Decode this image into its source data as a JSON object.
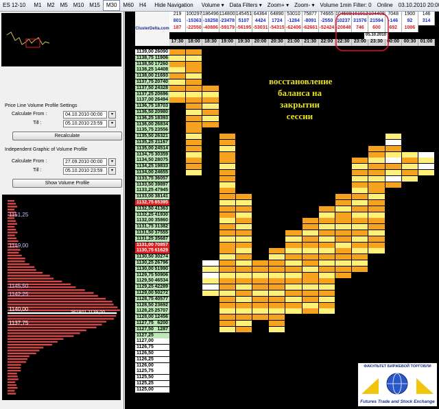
{
  "toolbar": {
    "items": [
      "ES 12-10",
      "M1",
      "M2",
      "M5",
      "M10",
      "M15",
      "M30",
      "M60",
      "H4",
      "Hide Navigation",
      "Volume ▾",
      "Data Filters ▾",
      "Zoom+ ▾",
      "Zoom- ▾",
      "Volume 1min Filter: 0",
      "Online",
      "03.10.2010 20:00 ▾"
    ]
  },
  "left": {
    "price_line_title": "Price Line Volume Profile Settings",
    "calc_from_label": "Calculate From :",
    "till_label": "Till :",
    "pl_from": "04.10.2010 00:00",
    "pl_till": "05.10.2010 23:59",
    "recalc": "Recalculate",
    "indep_title": "Independent Graphic of Volume Profile",
    "ig_from": "27.09.2010 00:00",
    "ig_till": "05.10.2010 23:59",
    "show_profile": "Show Volume Profile",
    "profile_prices": [
      "1151,25",
      "1149,00",
      "1145,50",
      "1142,25",
      "1140,00",
      "1137,75"
    ],
    "profile_max": "361801  1139,00"
  },
  "header": {
    "row1": [
      "219",
      "100297",
      "186496",
      "114800",
      "145451",
      "64364",
      "64890",
      "53010",
      "75877",
      "74665",
      "104509",
      "161912",
      "104408",
      "7048",
      "1900",
      "146"
    ],
    "row2": [
      "801",
      "-15363",
      "-18258",
      "-23478",
      "5107",
      "4424",
      "1724",
      "-1284",
      "-8091",
      "-2550",
      "10237",
      "31576",
      "21594",
      "-146",
      "92",
      "314"
    ],
    "row3": [
      "187",
      "-22550",
      "-40886",
      "-59179",
      "-56195",
      "-53031",
      "-54315",
      "-62406",
      "-62661",
      "-52424",
      "-20848",
      "746",
      "600",
      "692",
      "1006"
    ],
    "times": [
      "17:30",
      "18:00",
      "18:30",
      "19:00",
      "19:30",
      "20:00",
      "20:30",
      "21:00",
      "21:30",
      "22:00",
      "22:30",
      "23:00",
      "23:30",
      "00:00",
      "00:30",
      "01:00"
    ],
    "date_mark": "05.10.2010",
    "brand": "ClusterDelta.com"
  },
  "prices": [
    [
      "1139,00",
      "26090"
    ],
    [
      "1138,75",
      "11906"
    ],
    [
      "1138,50",
      "17260"
    ],
    [
      "1138,25",
      "14408"
    ],
    [
      "1138,00",
      "21693"
    ],
    [
      "1137,75",
      "20740"
    ],
    [
      "1137,50",
      "24328"
    ],
    [
      "1137,25",
      "20696"
    ],
    [
      "1137,00",
      "26494"
    ],
    [
      "1136,75",
      "18703"
    ],
    [
      "1136,50",
      "20980"
    ],
    [
      "1136,25",
      "18393"
    ],
    [
      "1136,00",
      "26834"
    ],
    [
      "1135,75",
      "23556"
    ],
    [
      "1135,50",
      "26321"
    ],
    [
      "1135,25",
      "21167"
    ],
    [
      "1135,00",
      "24514"
    ],
    [
      "1134,75",
      "30359"
    ],
    [
      "1134,50",
      "28075"
    ],
    [
      "1134,25",
      "19833"
    ],
    [
      "1134,00",
      "24655"
    ],
    [
      "1133,75",
      "36057"
    ],
    [
      "1133,50",
      "39897"
    ],
    [
      "1133,25",
      "47945"
    ],
    [
      "1133,00",
      "38141"
    ],
    [
      "1132,75",
      "65395"
    ],
    [
      "1132,50",
      "41363"
    ],
    [
      "1132,25",
      "41930"
    ],
    [
      "1132,00",
      "35860"
    ],
    [
      "1131,75",
      "31382"
    ],
    [
      "1131,50",
      "37555"
    ],
    [
      "1131,25",
      "35687"
    ],
    [
      "1131,00",
      "70857"
    ],
    [
      "1130,75",
      "61629"
    ],
    [
      "1130,50",
      "30274"
    ],
    [
      "1130,25",
      "26796"
    ],
    [
      "1130,00",
      "51990"
    ],
    [
      "1129,75",
      "50906"
    ],
    [
      "1129,50",
      "46534"
    ],
    [
      "1129,25",
      "42289"
    ],
    [
      "1129,00",
      "50272"
    ],
    [
      "1128,75",
      "40577"
    ],
    [
      "1128,50",
      "23692"
    ],
    [
      "1128,25",
      "25707"
    ],
    [
      "1128,00",
      "12456"
    ],
    [
      "1127,75",
      "6200"
    ],
    [
      "1127,50",
      "1287"
    ],
    [
      "1127,25",
      ""
    ],
    [
      "1127,00",
      ""
    ],
    [
      "1126,75",
      ""
    ],
    [
      "1126,50",
      ""
    ],
    [
      "1126,25",
      ""
    ],
    [
      "1126,00",
      ""
    ],
    [
      "1125,75",
      ""
    ],
    [
      "1125,50",
      ""
    ],
    [
      "1125,25",
      ""
    ],
    [
      "1125,00",
      ""
    ]
  ],
  "overlay": [
    "восстановление",
    "баланса на",
    "закрытии",
    "сессии"
  ],
  "logo": {
    "top": "ФАКУЛЬТЕТ БИРЖЕВОЙ ТОРГОВЛИ",
    "bottom": "Futures Trade and Stock Exchange"
  },
  "colors": {
    "orange": "#f5a21e",
    "yellow": "#fff07a",
    "white": "#ffffff",
    "red": "#e02020",
    "green_col": "#bfe8b8",
    "highlight_ring": "#e0102a"
  }
}
